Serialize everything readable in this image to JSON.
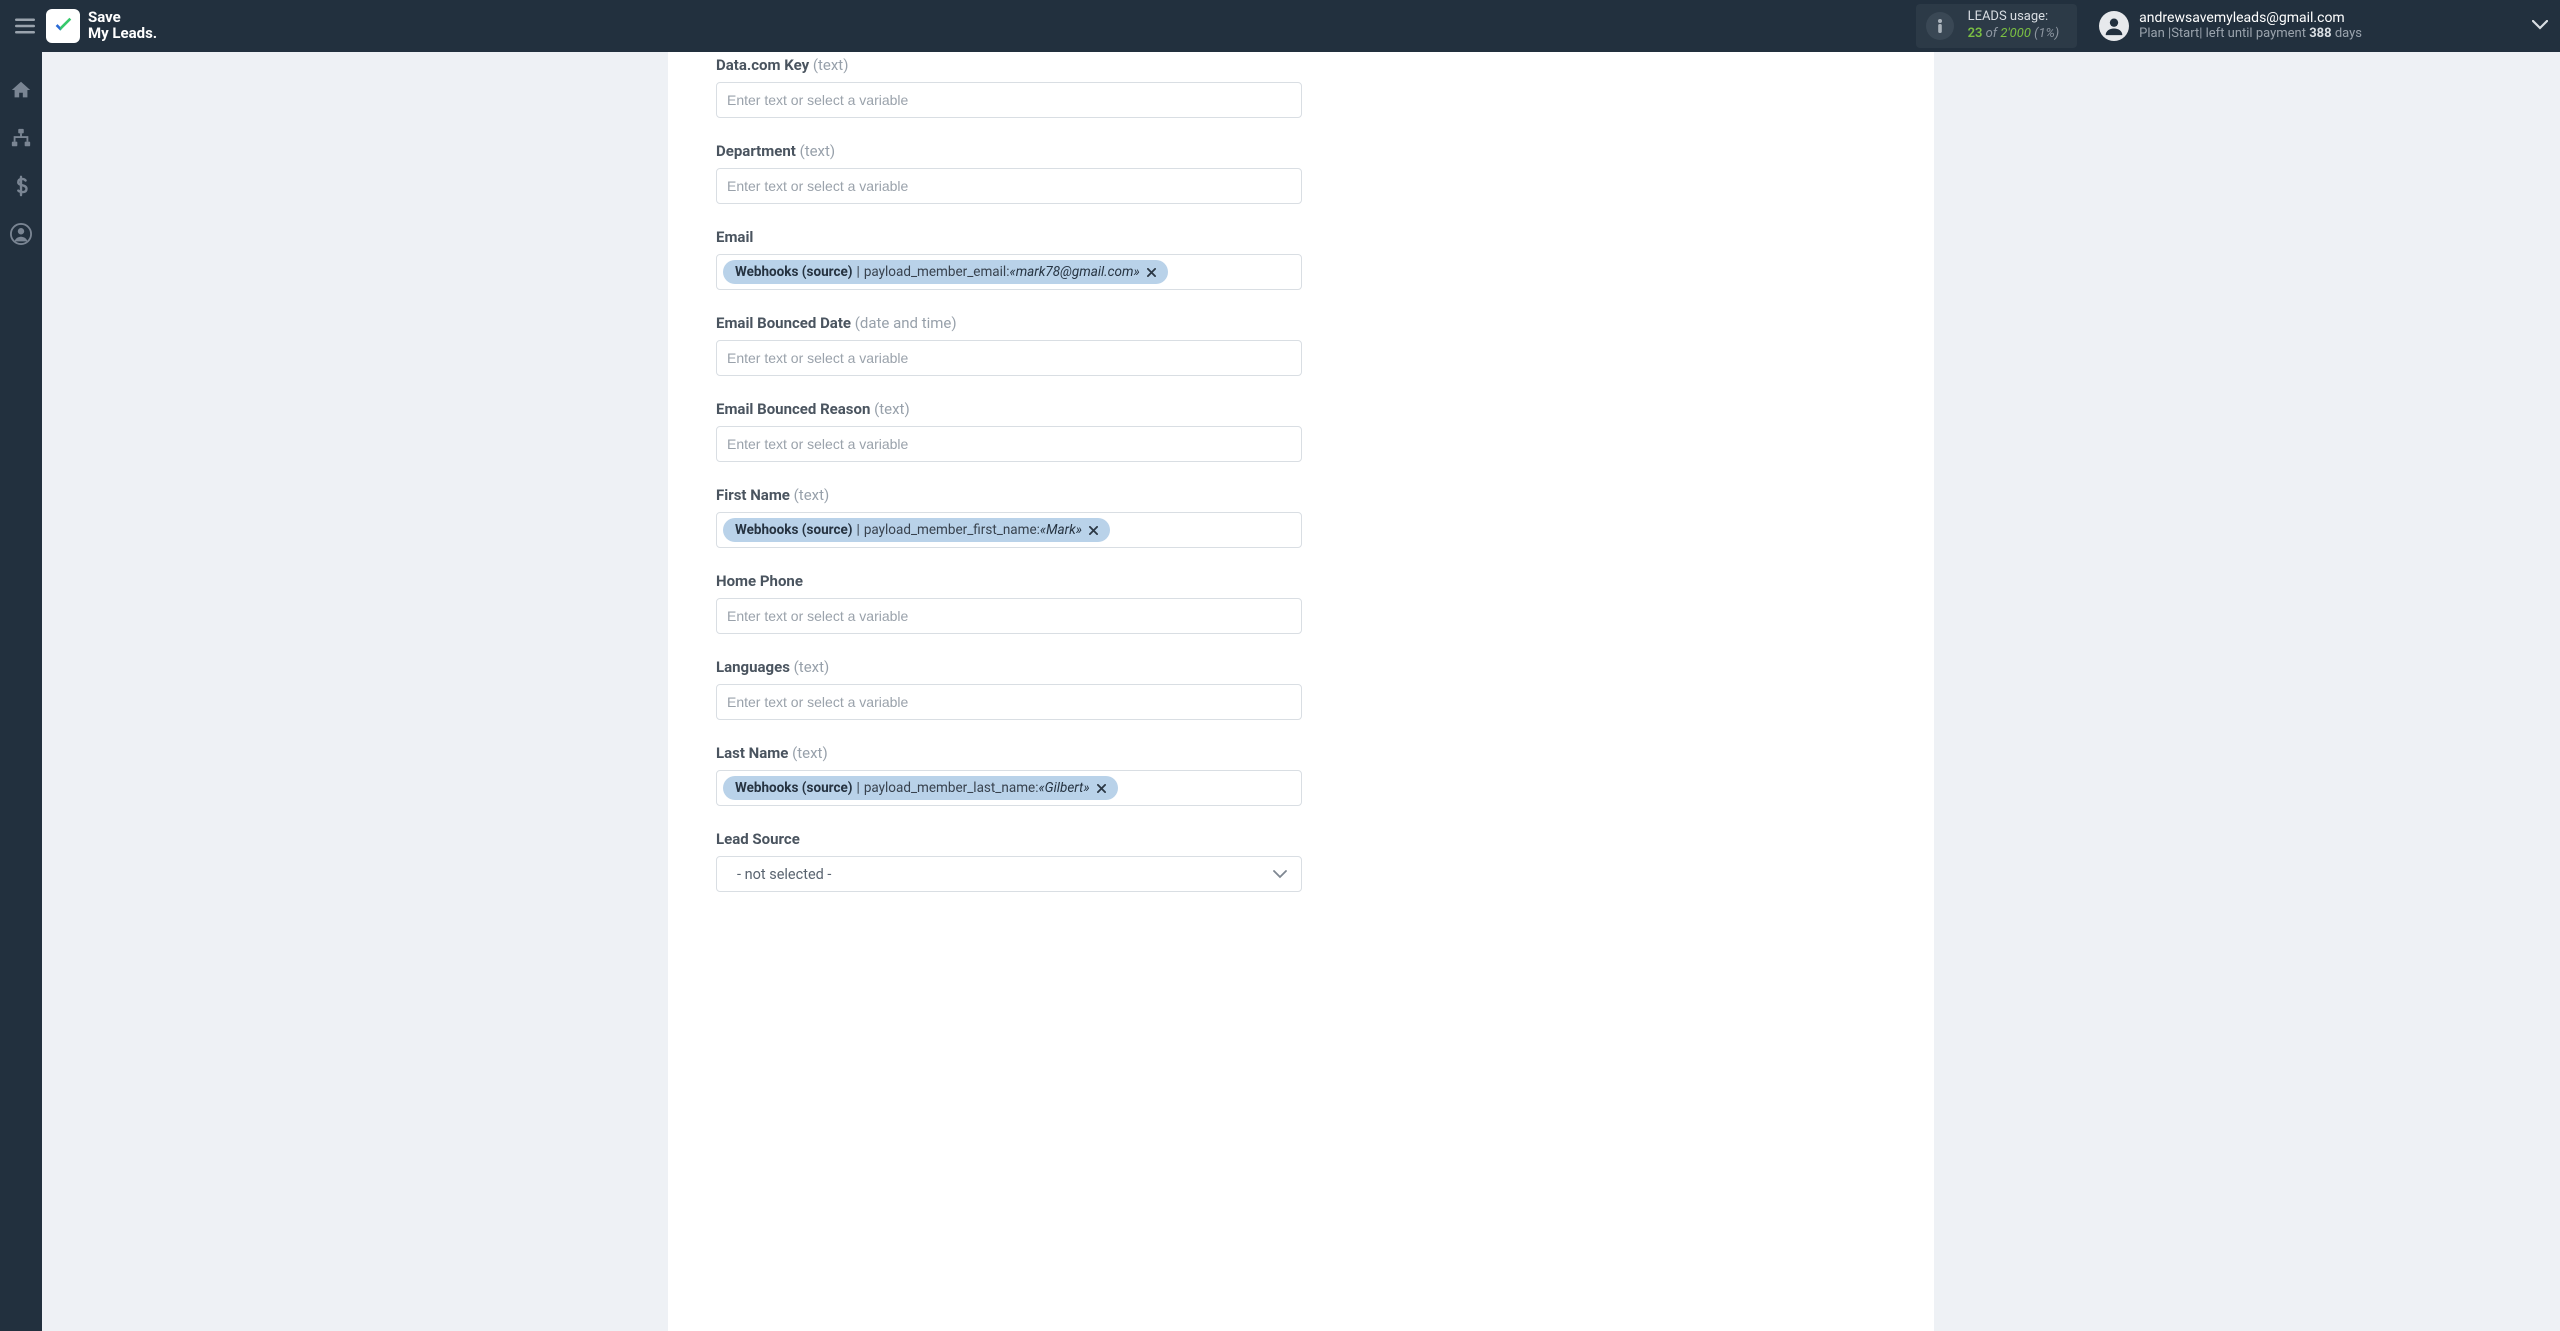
{
  "brand": {
    "line1": "Save",
    "line2": "My Leads."
  },
  "usage": {
    "title": "LEADS usage:",
    "count": "23",
    "of": " of ",
    "total": "2'000",
    "pct": " (1%)"
  },
  "account": {
    "email": "andrewsavemyleads@gmail.com",
    "plan_prefix": "Plan |",
    "plan_name": "Start",
    "plan_mid": "| left until payment ",
    "plan_days": "388",
    "plan_suffix": " days"
  },
  "placeholder": "Enter text or select a variable",
  "fields": {
    "datacom": {
      "label": "Data.com Key",
      "type": "(text)"
    },
    "department": {
      "label": "Department",
      "type": "(text)"
    },
    "email": {
      "label": "Email",
      "type": ""
    },
    "ebd": {
      "label": "Email Bounced Date",
      "type": "(date and time)"
    },
    "ebr": {
      "label": "Email Bounced Reason",
      "type": "(text)"
    },
    "first": {
      "label": "First Name",
      "type": "(text)"
    },
    "homephone": {
      "label": "Home Phone",
      "type": ""
    },
    "languages": {
      "label": "Languages",
      "type": "(text)"
    },
    "last": {
      "label": "Last Name",
      "type": "(text)"
    },
    "leadsrc": {
      "label": "Lead Source",
      "type": ""
    }
  },
  "chips": {
    "source_label": "Webhooks (source)",
    "email": {
      "var": "payload_member_email: ",
      "val": "«mark78@gmail.com»"
    },
    "first": {
      "var": "payload_member_first_name: ",
      "val": "«Mark»"
    },
    "last": {
      "var": "payload_member_last_name: ",
      "val": "«Gilbert»"
    }
  },
  "select": {
    "leadsrc_value": "- not selected -"
  }
}
